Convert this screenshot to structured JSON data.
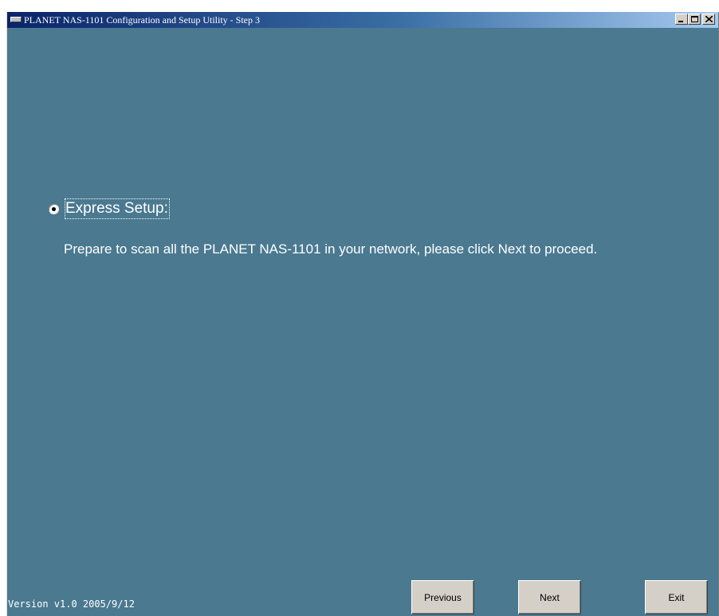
{
  "window": {
    "title": "PLANET NAS-1101 Configuration and Setup Utility - Step 3"
  },
  "colors": {
    "background": "#4a7990",
    "text": "#ffffff",
    "button_face": "#d4d0c8"
  },
  "option": {
    "label": "Express Setup:",
    "selected": true,
    "description": "Prepare to scan all the PLANET NAS-1101 in your network, please click Next to proceed."
  },
  "footer": {
    "version": "Version v1.0  2005/9/12"
  },
  "buttons": {
    "previous": "Previous",
    "next": "Next",
    "exit": "Exit"
  },
  "icons": {
    "app": "app-window-icon",
    "minimize": "minimize-icon",
    "maximize": "maximize-icon",
    "close": "close-icon"
  }
}
